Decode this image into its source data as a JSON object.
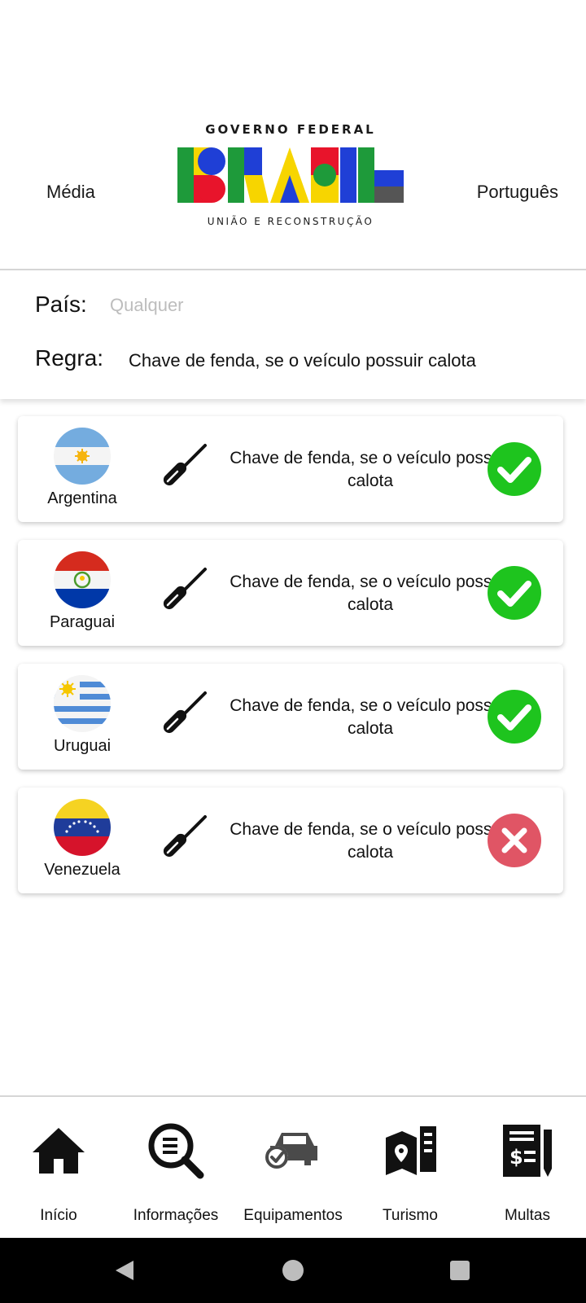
{
  "header": {
    "left_label": "Média",
    "right_label": "Português",
    "logo": {
      "top_text": "GOVERNO FEDERAL",
      "main_text": "BRASIL",
      "bottom_text": "UNIÃO E RECONSTRUÇÃO"
    }
  },
  "filters": {
    "country_label": "País:",
    "country_placeholder": "Qualquer",
    "rule_label": "Regra:",
    "rule_value": "Chave de fenda, se o veículo possuir calota"
  },
  "results": [
    {
      "country": "Argentina",
      "flag_icon": "argentina-flag-icon",
      "rule": "Chave de fenda, se o veículo possuir calota",
      "status": "allowed",
      "status_icon": "check-icon"
    },
    {
      "country": "Paraguai",
      "flag_icon": "paraguay-flag-icon",
      "rule": "Chave de fenda, se o veículo possuir calota",
      "status": "allowed",
      "status_icon": "check-icon"
    },
    {
      "country": "Uruguai",
      "flag_icon": "uruguay-flag-icon",
      "rule": "Chave de fenda, se o veículo possuir calota",
      "status": "allowed",
      "status_icon": "check-icon"
    },
    {
      "country": "Venezuela",
      "flag_icon": "venezuela-flag-icon",
      "rule": "Chave de fenda, se o veículo possuir calota",
      "status": "not-allowed",
      "status_icon": "close-icon"
    }
  ],
  "nav": [
    {
      "label": "Início",
      "icon": "home-icon"
    },
    {
      "label": "Informações",
      "icon": "search-info-icon"
    },
    {
      "label": "Equipamentos",
      "icon": "car-check-icon"
    },
    {
      "label": "Turismo",
      "icon": "map-icon"
    },
    {
      "label": "Multas",
      "icon": "fine-document-icon"
    }
  ],
  "colors": {
    "ok": "#1ec41e",
    "error": "#e05565",
    "divider": "#d6d6d6",
    "placeholder": "#bdbdbd"
  }
}
